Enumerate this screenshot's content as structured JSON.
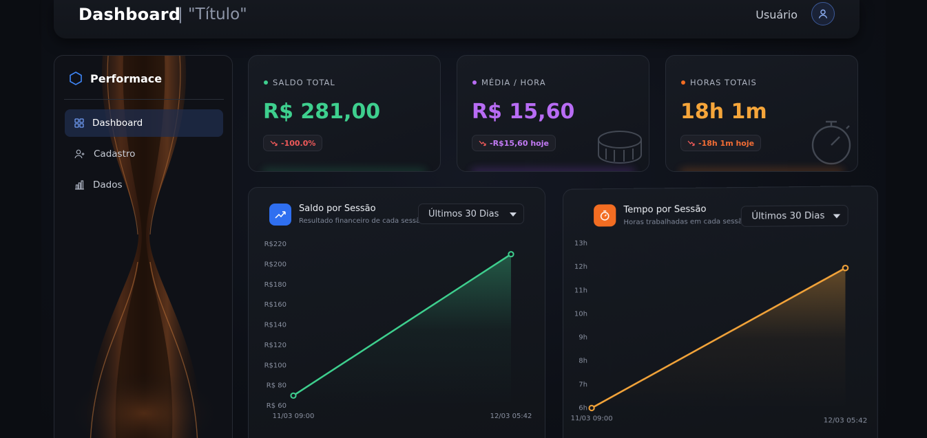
{
  "header": {
    "title": "Dashboard",
    "subtitle": "| \"Título\"",
    "user_label": "Usuário",
    "avatar_icon": "user-icon"
  },
  "sidebar": {
    "brand": "Performace",
    "brand_icon": "hexagon-icon",
    "items": [
      {
        "label": "Dashboard",
        "icon": "grid-icon",
        "active": true
      },
      {
        "label": "Cadastro",
        "icon": "user-plus-icon",
        "active": false
      },
      {
        "label": "Dados",
        "icon": "bar-chart-icon",
        "active": false
      }
    ]
  },
  "stats": [
    {
      "label": "SALDO TOTAL",
      "value": "R$ 281,00",
      "delta": "-100.0%",
      "color": "#3ecf8e",
      "delta_color": "#f05a5a",
      "deco": "none"
    },
    {
      "label": "MÉDIA / HORA",
      "value": "R$ 15,60",
      "delta": "-R$15,60 hoje",
      "color": "#b86cf4",
      "delta_color": "#c37af5",
      "deco": "coins-icon"
    },
    {
      "label": "HORAS TOTAIS",
      "value": "18h 1m",
      "delta": "-18h 1m hoje",
      "color": "#f5a53a",
      "delta_color": "#f36d35",
      "deco": "stopwatch-icon"
    }
  ],
  "charts": {
    "saldo": {
      "title": "Saldo por Sessão",
      "subtitle": "Resultado financeiro de cada sessão",
      "range": "Últimos 30 Dias",
      "icon": "trending-up-icon",
      "accent": "#3a7bf2",
      "line_color": "#3ecf8e"
    },
    "tempo": {
      "title": "Tempo por Sessão",
      "subtitle": "Horas trabalhadas em cada sessão",
      "range": "Últimos 30 Dias",
      "icon": "timer-icon",
      "accent": "#f36d22",
      "line_color": "#f5a53a"
    }
  },
  "chart_data": [
    {
      "type": "area",
      "title": "Saldo por Sessão",
      "x": [
        "11/03 09:00",
        "12/03 05:42"
      ],
      "x_tick_labels": [
        "11/03 09:00",
        "12/03 05:42"
      ],
      "y_tick_labels": [
        "R$ 60",
        "R$ 80",
        "R$100",
        "R$120",
        "R$140",
        "R$160",
        "R$180",
        "R$200",
        "R$220"
      ],
      "y_ticks": [
        60,
        80,
        100,
        120,
        140,
        160,
        180,
        200,
        220
      ],
      "ylim": [
        60,
        220
      ],
      "values": [
        70,
        210
      ],
      "grid": false
    },
    {
      "type": "area",
      "title": "Tempo por Sessão",
      "x": [
        "11/03 09:00",
        "12/03 05:42"
      ],
      "x_tick_labels": [
        "11/03 09:00",
        "12/03 05:42"
      ],
      "y_tick_labels": [
        "6h",
        "7h",
        "8h",
        "9h",
        "10h",
        "11h",
        "12h",
        "13h"
      ],
      "y_ticks": [
        6,
        7,
        8,
        9,
        10,
        11,
        12,
        13
      ],
      "ylim": [
        6,
        13
      ],
      "values": [
        6,
        11.9
      ],
      "grid": false
    }
  ]
}
